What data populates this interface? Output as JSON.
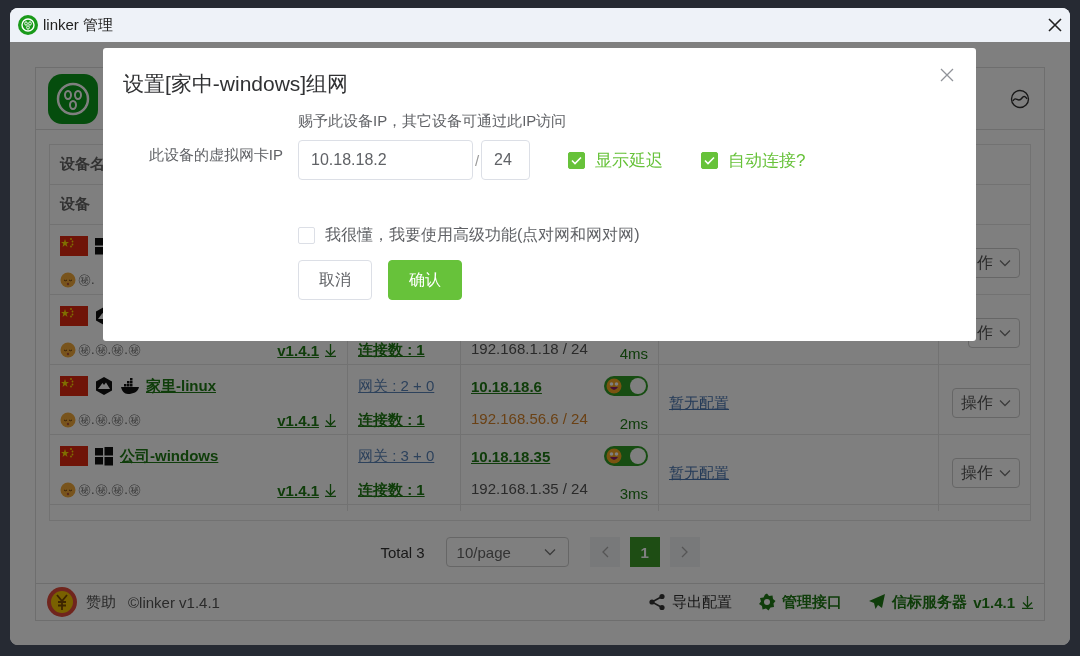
{
  "window": {
    "title": "linker 管理"
  },
  "table": {
    "headers": [
      "设备名",
      "设备"
    ],
    "rows": [
      {
        "os": [
          {
            "kind": "windows"
          }
        ],
        "secret": "㊙.",
        "action": "作"
      },
      {
        "os": [
          {
            "kind": "hexagon"
          }
        ],
        "secret": "㊙.㊙.㊙.㊙",
        "version": "v1.4.1",
        "connections": "连接数 : 1",
        "lan": "192.168.1.18 / 24",
        "lan_warning": false,
        "latency": "4ms",
        "action": "作"
      },
      {
        "os": [
          {
            "kind": "hexagon"
          },
          {
            "kind": "whale"
          }
        ],
        "name": "家里-linux",
        "secret": "㊙.㊙.㊙.㊙",
        "version": "v1.4.1",
        "gateway": "网关 : 2 + 0",
        "connections": "连接数 : 1",
        "ip": "10.18.18.6",
        "toggle_on": true,
        "lan": "192.168.56.6 / 24",
        "lan_warning": true,
        "latency": "2ms",
        "config": "暂无配置",
        "action": "操作"
      },
      {
        "os": [
          {
            "kind": "windows"
          }
        ],
        "name": "公司-windows",
        "secret": "㊙.㊙.㊙.㊙",
        "version": "v1.4.1",
        "gateway": "网关 : 3 + 0",
        "connections": "连接数 : 1",
        "ip": "10.18.18.35",
        "toggle_on": true,
        "lan": "192.168.1.35 / 24",
        "lan_warning": false,
        "latency": "3ms",
        "config": "暂无配置",
        "action": "操作"
      }
    ]
  },
  "pagination": {
    "total": "Total 3",
    "page_size": "10/page",
    "pages": [
      {
        "label": "1",
        "selected": true
      }
    ]
  },
  "footer": {
    "sponsor": "赞助",
    "copyright": "©linker v1.4.1",
    "links": [
      {
        "kind": "share",
        "label": "导出配置"
      },
      {
        "kind": "gear",
        "label": "管理接口"
      },
      {
        "kind": "plane",
        "label": "信标服务器",
        "version": "v1.4.1"
      }
    ]
  },
  "dialog": {
    "title": "设置[家中-windows]组网",
    "hint": "赐予此设备IP，其它设备可通过此IP访问",
    "ip_label": "此设备的虚拟网卡IP",
    "ip": "10.18.18.2",
    "separator": "/",
    "mask": "24",
    "options": [
      {
        "label": "显示延迟",
        "checked": true
      },
      {
        "label": "自动连接?",
        "checked": true
      }
    ],
    "advanced": {
      "label": "我很懂，我要使用高级功能(点对网和网对网)",
      "checked": false
    },
    "buttons": [
      {
        "kind": "cancel",
        "label": "取消"
      },
      {
        "kind": "confirm",
        "label": "确认"
      }
    ]
  }
}
